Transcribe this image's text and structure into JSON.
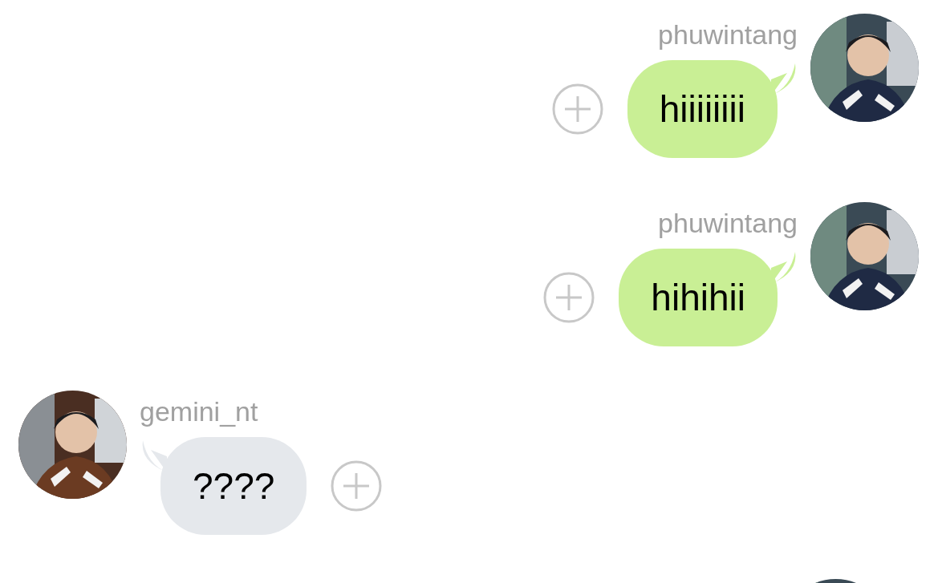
{
  "messages": [
    {
      "kind": "sent",
      "sender": "phuwintang",
      "text": "hiiiiiiii"
    },
    {
      "kind": "sent",
      "sender": "phuwintang",
      "text": "hihihii"
    },
    {
      "kind": "received",
      "sender": "gemini_nt",
      "text": "????"
    },
    {
      "kind": "avatar"
    }
  ]
}
